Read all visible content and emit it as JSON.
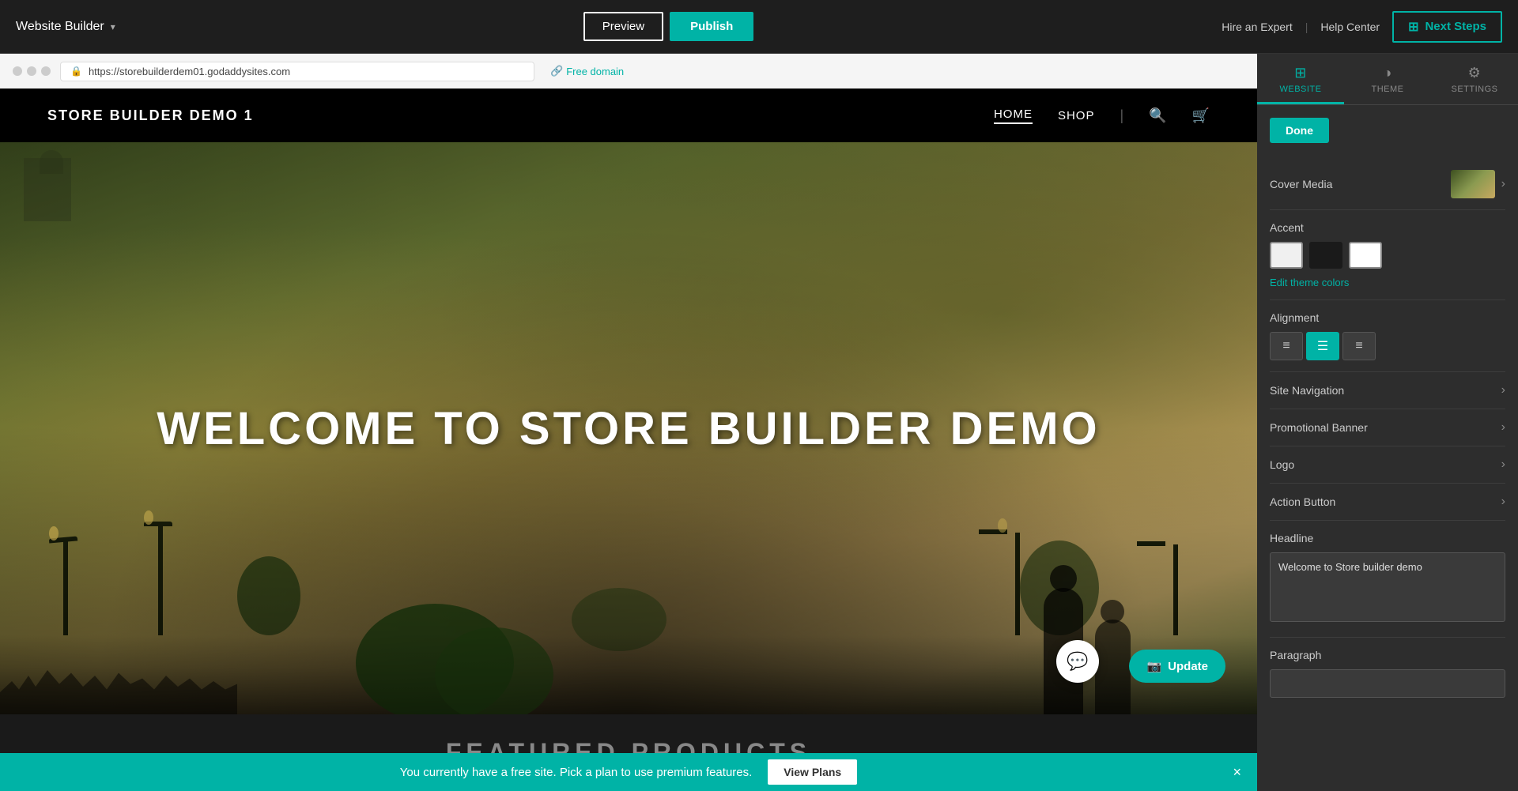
{
  "header": {
    "site_title": "Website Builder",
    "chevron": "▾",
    "preview_label": "Preview",
    "publish_label": "Publish",
    "hire_expert": "Hire an Expert",
    "help_center": "Help Center",
    "next_steps_label": "Next Steps",
    "next_steps_icon": "⊞"
  },
  "browser": {
    "url": "https://storebuilderdem01.godaddysites.com",
    "free_domain_label": "Free domain",
    "free_domain_icon": "🔗"
  },
  "site": {
    "logo": "STORE BUILDER DEMO 1",
    "nav_links": [
      "HOME",
      "SHOP"
    ],
    "hero_text": "WELCOME TO STORE BUILDER DEMO",
    "featured_title": "FEATURED PRODUCTS",
    "update_btn": "Update",
    "update_icon": "📷"
  },
  "promo_bar": {
    "text": "You currently have a free site. Pick a plan to use premium features.",
    "cta_label": "View Plans",
    "close_icon": "×"
  },
  "panel": {
    "tabs": [
      {
        "id": "website",
        "label": "WEBSITE",
        "icon": "⊞",
        "active": true
      },
      {
        "id": "theme",
        "label": "THEME",
        "icon": "◑"
      },
      {
        "id": "settings",
        "label": "SETTINGS",
        "icon": "⚙"
      }
    ],
    "done_label": "Done",
    "cover_media_label": "Cover Media",
    "accent_label": "Accent",
    "edit_theme_label": "Edit theme colors",
    "alignment_label": "Alignment",
    "accent_colors": [
      {
        "hex": "#f0f0f0",
        "selected": false
      },
      {
        "hex": "#1a1a1a",
        "selected": false
      },
      {
        "hex": "#ffffff",
        "selected": false
      }
    ],
    "site_navigation_label": "Site Navigation",
    "promotional_banner_label": "Promotional Banner",
    "logo_label": "Logo",
    "action_button_label": "Action Button",
    "headline_label": "Headline",
    "headline_value": "Welcome to Store builder demo",
    "paragraph_label": "Paragraph",
    "paragraph_placeholder": ""
  }
}
